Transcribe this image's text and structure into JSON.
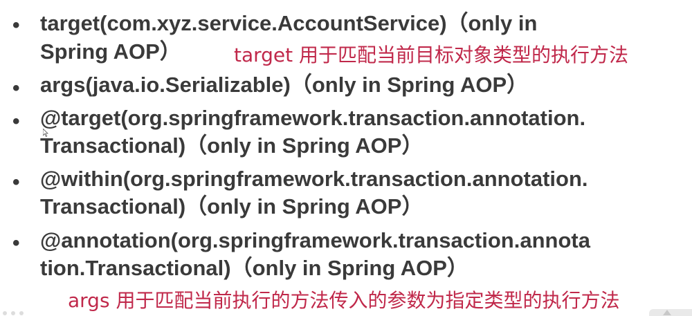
{
  "slide": {
    "bullet_symbol": "•",
    "items": [
      {
        "lines": [
          "target(com.xyz.service.AccountService)（only in",
          "Spring AOP）"
        ]
      },
      {
        "lines": [
          "args(java.io.Serializable)（only in Spring AOP）"
        ]
      },
      {
        "lines": [
          "@target(org.springframework.transaction.annotation.",
          "Transactional)（only in Spring AOP）"
        ]
      },
      {
        "lines": [
          "@within(org.springframework.transaction.annotation.",
          "Transactional)（only in Spring AOP）"
        ]
      },
      {
        "lines": [
          "@annotation(org.springframework.transaction.annota",
          "tion.Transactional)（only in Spring AOP）"
        ]
      }
    ],
    "notes": {
      "target_note": "target 用于匹配当前目标对象类型的执行方法",
      "args_note": "args 用于匹配当前执行的方法传入的参数为指定类型的执行方法"
    }
  },
  "colors": {
    "text": "#3a3a3a",
    "annotation": "#c0284a",
    "background": "#ffffff"
  },
  "icons": {
    "pointer": "mouse-cursor-icon"
  }
}
